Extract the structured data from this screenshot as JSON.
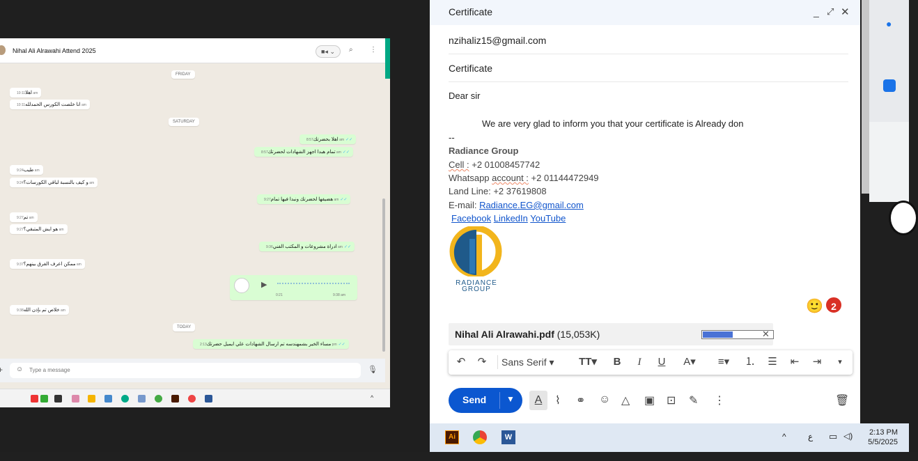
{
  "whatsapp": {
    "chat_title": "Nihal Ali Alrawahi Attend 2025",
    "days": [
      "FRIDAY",
      "SATURDAY",
      "TODAY"
    ],
    "messages": [
      {
        "dir": "in",
        "text": "اهلا",
        "time": "10:11 am"
      },
      {
        "dir": "in",
        "text": "انا خلصت الكورس الحمدلله",
        "time": "10:11 am"
      },
      {
        "dir": "out",
        "text": "اهلا بحضرتك",
        "time": "8:57 am"
      },
      {
        "dir": "out",
        "text": "تمام هبدا اجهز الشهادات لحضرتك",
        "time": "8:57 am"
      },
      {
        "dir": "in",
        "text": "طيب",
        "time": "9:24 am"
      },
      {
        "dir": "in",
        "text": "و كيف بالنسبة لباقي الكورسات؟",
        "time": "9:24 am"
      },
      {
        "dir": "out",
        "text": "هضيفها لحضرتك ونبدا فيها تمام",
        "time": "9:27 am"
      },
      {
        "dir": "in",
        "text": "تم",
        "time": "9:27 am"
      },
      {
        "dir": "in",
        "text": "هو ايش المتبقي؟",
        "time": "9:27 am"
      },
      {
        "dir": "out",
        "text": "ادراة مشروعات و المكتب الفني",
        "time": "9:36 am"
      },
      {
        "dir": "in",
        "text": "ممكن اعرف الفرق بينهم؟",
        "time": "9:37 am"
      },
      {
        "dir": "in",
        "text": "خلاص تم بإذن الله",
        "time": "9:38 am"
      },
      {
        "dir": "out",
        "text": "مساء الخير  بشمهندسه تم ارسال الشهادات علي ايميل حضرتك",
        "time": "2:13 pm"
      }
    ],
    "voice": {
      "duration": "0:21",
      "time": "9:38 am"
    },
    "input_placeholder": "Type a message"
  },
  "compose": {
    "title": "Certificate",
    "to": "nzihaliz15@gmail.com",
    "subject": "Certificate",
    "greeting": "Dear sir",
    "line1": "We are very glad to inform you that your certificate is Already don",
    "sig_sep": "--",
    "company": "Radiance Group",
    "cell_label": "Cell :",
    "cell": " +2 01008457742",
    "wa_label_a": "Whatsapp ",
    "wa_label_b": "account :",
    "whatsapp": " +2 01144472949",
    "landline": "Land Line: +2 37619808",
    "email_label": "E-mail: ",
    "email": "Radiance.EG@gmail.com",
    "links": [
      "Facebook",
      "LinkedIn",
      "YouTube"
    ],
    "logo_text": [
      "RADIANCE",
      "GROUP"
    ],
    "attachment_name": "Nihal Ali Alrawahi.pdf",
    "attachment_size": "(15,053K)",
    "attachment_progress": 0.42,
    "font": "Sans Serif",
    "send_label": "Send",
    "badge": "2"
  },
  "taskbar": {
    "time": "2:13 PM",
    "date": "5/5/2025",
    "lang": "ع"
  },
  "colors": {
    "wa_green": "#00a884",
    "out_bubble": "#d9fdd3",
    "send_blue": "#0b57d0"
  }
}
